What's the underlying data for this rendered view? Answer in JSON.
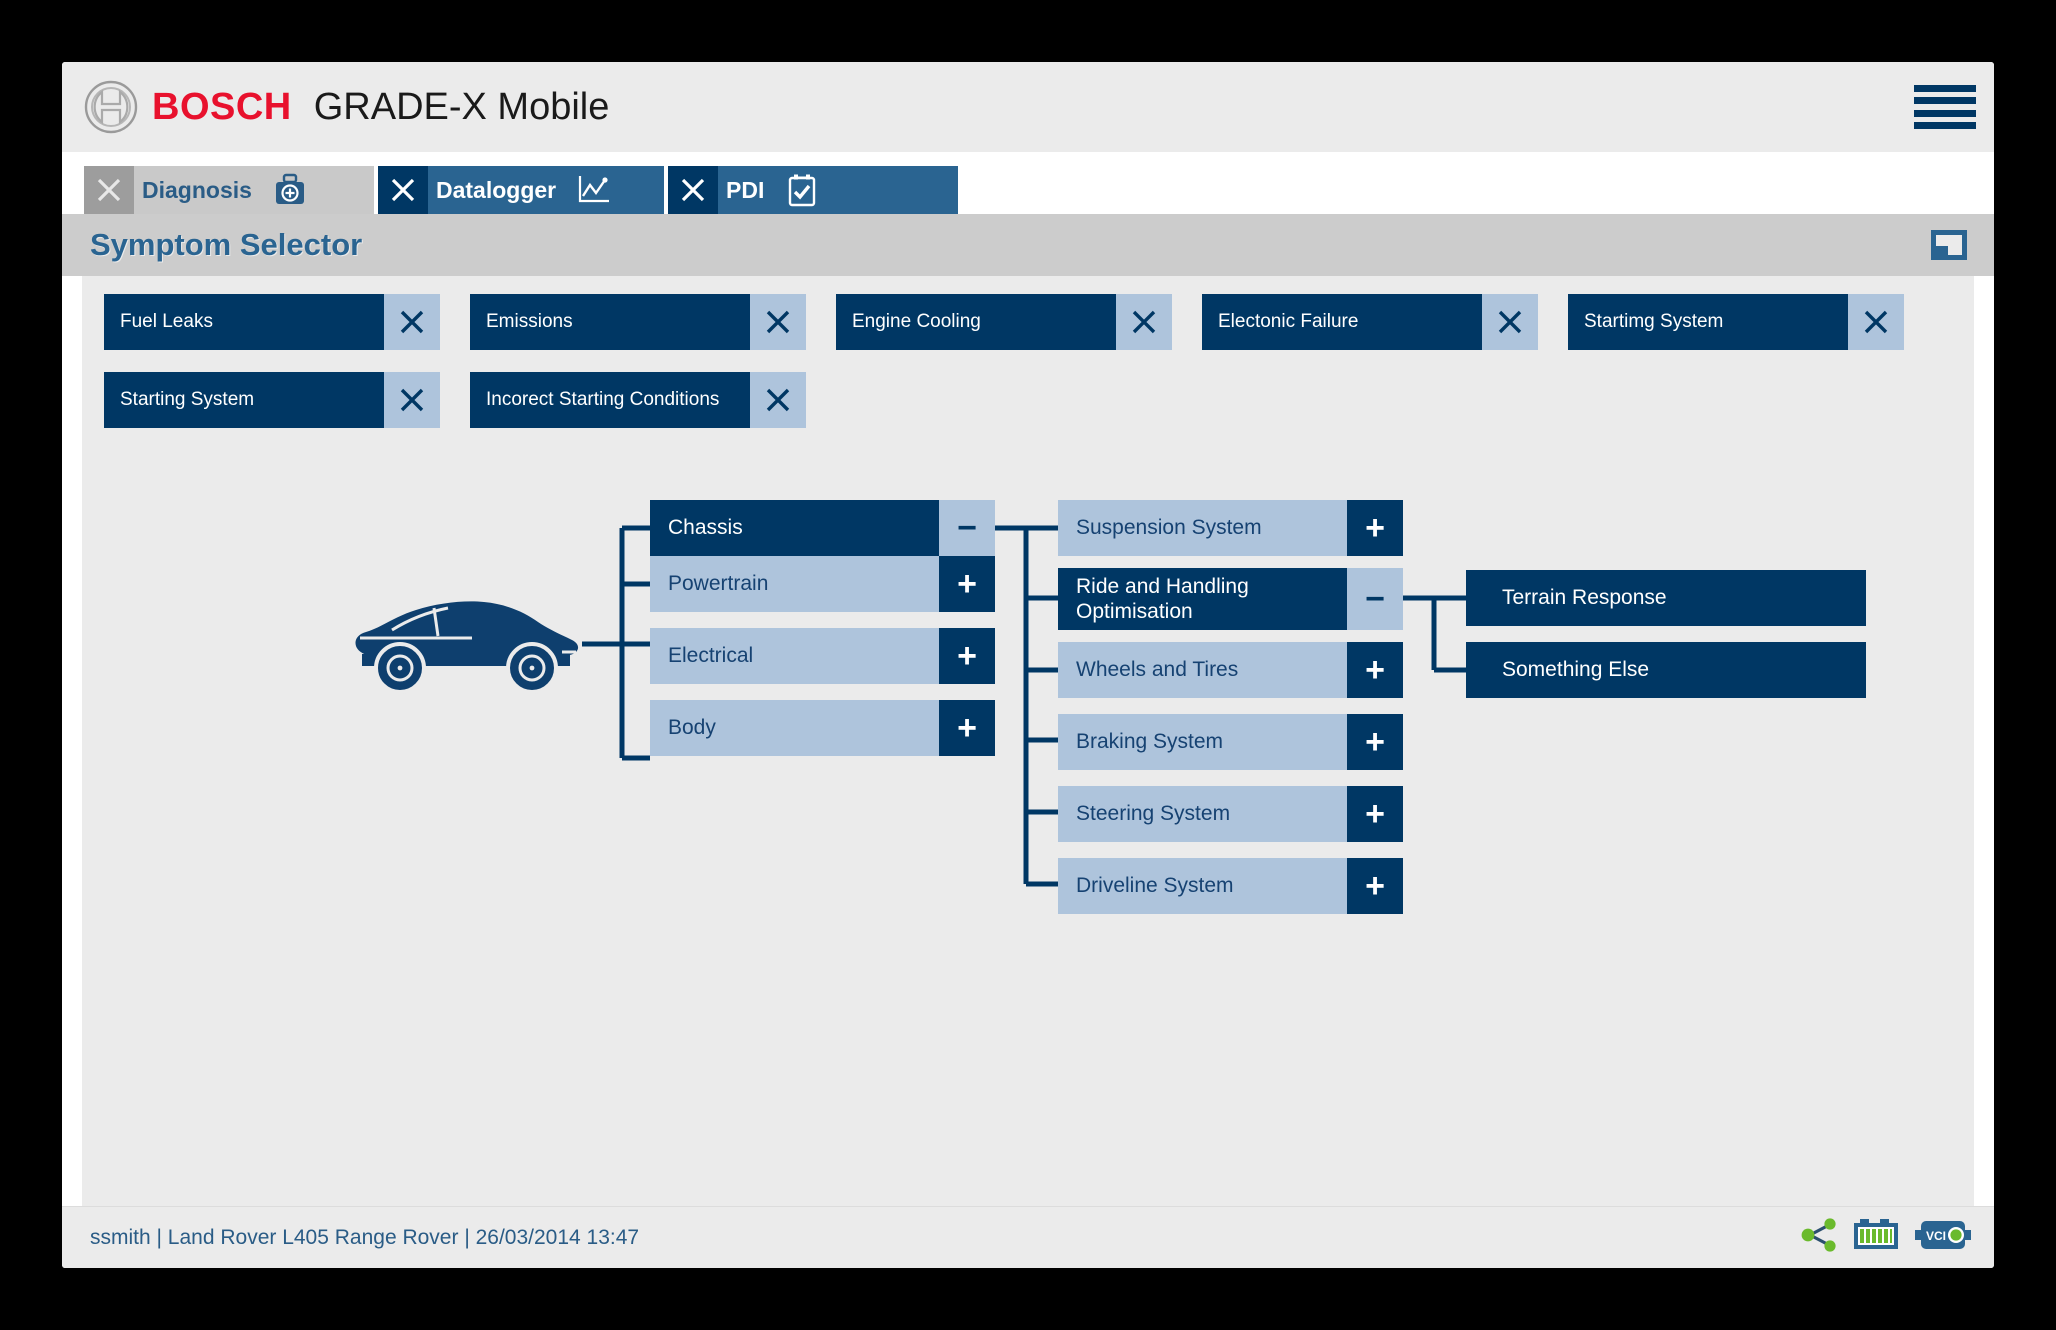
{
  "brand": {
    "logo_icon": "bosch-logo-icon",
    "wordmark": "BOSCH",
    "app_title": "GRADE-X Mobile",
    "menu_icon": "hamburger-menu-icon",
    "accent_red": "#e8112d",
    "navy": "#003764",
    "mid_blue": "#2a6491",
    "light_blue": "#aec4dc"
  },
  "tabs": [
    {
      "label": "Diagnosis",
      "icon": "medical-kit-icon",
      "close_icon": "close-icon",
      "active": false
    },
    {
      "label": "Datalogger",
      "icon": "line-chart-icon",
      "close_icon": "close-icon",
      "active": true
    },
    {
      "label": "PDI",
      "icon": "clipboard-check-icon",
      "close_icon": "close-icon",
      "active": true
    }
  ],
  "section": {
    "title": "Symptom Selector",
    "expand_icon": "expand-window-icon"
  },
  "chips": [
    {
      "label": "Fuel Leaks",
      "remove_icon": "close-icon"
    },
    {
      "label": "Emissions",
      "remove_icon": "close-icon"
    },
    {
      "label": "Engine Cooling",
      "remove_icon": "close-icon"
    },
    {
      "label": "Electonic Failure",
      "remove_icon": "close-icon"
    },
    {
      "label": "Startimg System",
      "remove_icon": "close-icon"
    },
    {
      "label": "Starting System",
      "remove_icon": "close-icon"
    },
    {
      "label": "Incorect Starting Conditions",
      "remove_icon": "close-icon"
    }
  ],
  "tree": {
    "root_icon": "car-side-icon",
    "level1": [
      {
        "label": "Chassis",
        "state": "expanded",
        "button": "−"
      },
      {
        "label": "Powertrain",
        "state": "collapsed",
        "button": "+"
      },
      {
        "label": "Electrical",
        "state": "collapsed",
        "button": "+"
      },
      {
        "label": "Body",
        "state": "collapsed",
        "button": "+"
      }
    ],
    "level2": [
      {
        "label": "Suspension System",
        "state": "collapsed",
        "button": "+"
      },
      {
        "label": "Ride and Handling Optimisation",
        "state": "expanded",
        "button": "−"
      },
      {
        "label": "Wheels and Tires",
        "state": "collapsed",
        "button": "+"
      },
      {
        "label": "Braking System",
        "state": "collapsed",
        "button": "+"
      },
      {
        "label": "Steering System",
        "state": "collapsed",
        "button": "+"
      },
      {
        "label": "Driveline System",
        "state": "collapsed",
        "button": "+"
      }
    ],
    "level3": [
      {
        "label": "Terrain Response",
        "state": "leaf"
      },
      {
        "label": "Something Else",
        "state": "leaf"
      }
    ]
  },
  "status": {
    "text": "ssmith |  Land Rover L405 Range Rover | 26/03/2014 13:47",
    "user": "ssmith",
    "vehicle": "Land Rover L405 Range Rover",
    "timestamp": "26/03/2014 13:47",
    "icons": [
      {
        "name": "share-network-icon"
      },
      {
        "name": "battery-full-icon"
      },
      {
        "name": "vci-connector-icon",
        "label": "VCI"
      }
    ]
  }
}
